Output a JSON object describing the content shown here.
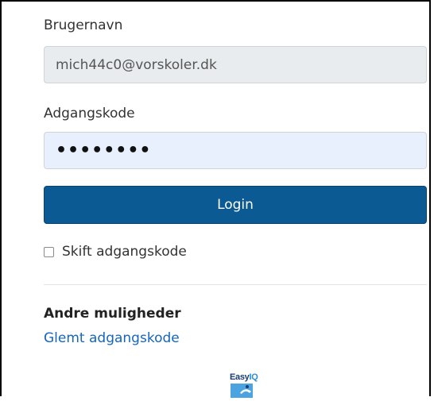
{
  "form": {
    "username_label": "Brugernavn",
    "username_value": "mich44c0@vorskoler.dk",
    "password_label": "Adgangskode",
    "password_value": "••••••••",
    "login_label": "Login",
    "change_password_label": "Skift adgangskode",
    "change_password_checked": false
  },
  "other": {
    "title": "Andre muligheder",
    "forgot_password_link": "Glemt adgangskode"
  },
  "logo": {
    "text_part1": "Easy",
    "text_part2": "IQ",
    "icon": "easyiq-logo"
  },
  "colors": {
    "primary_button": "#0c5a93",
    "link": "#1565c0",
    "readonly_field": "#e9ecef",
    "autofill_field": "#e8f0fe"
  }
}
